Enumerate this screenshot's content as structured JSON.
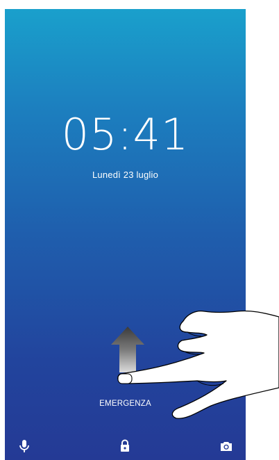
{
  "lockscreen": {
    "time": "05:41",
    "date": "Lunedì 23 luglio",
    "emergency_label": "EMERGENZA"
  },
  "bottom_bar": {
    "left_icon": "microphone-icon",
    "center_icon": "lock-icon",
    "right_icon": "camera-icon"
  },
  "overlay": {
    "gesture_hint": "swipe-up-arrow-icon",
    "illustration": "pointing-hand"
  },
  "colors": {
    "gradient_top": "#1aa0cc",
    "gradient_bottom": "#243a95",
    "text": "#ffffff"
  }
}
